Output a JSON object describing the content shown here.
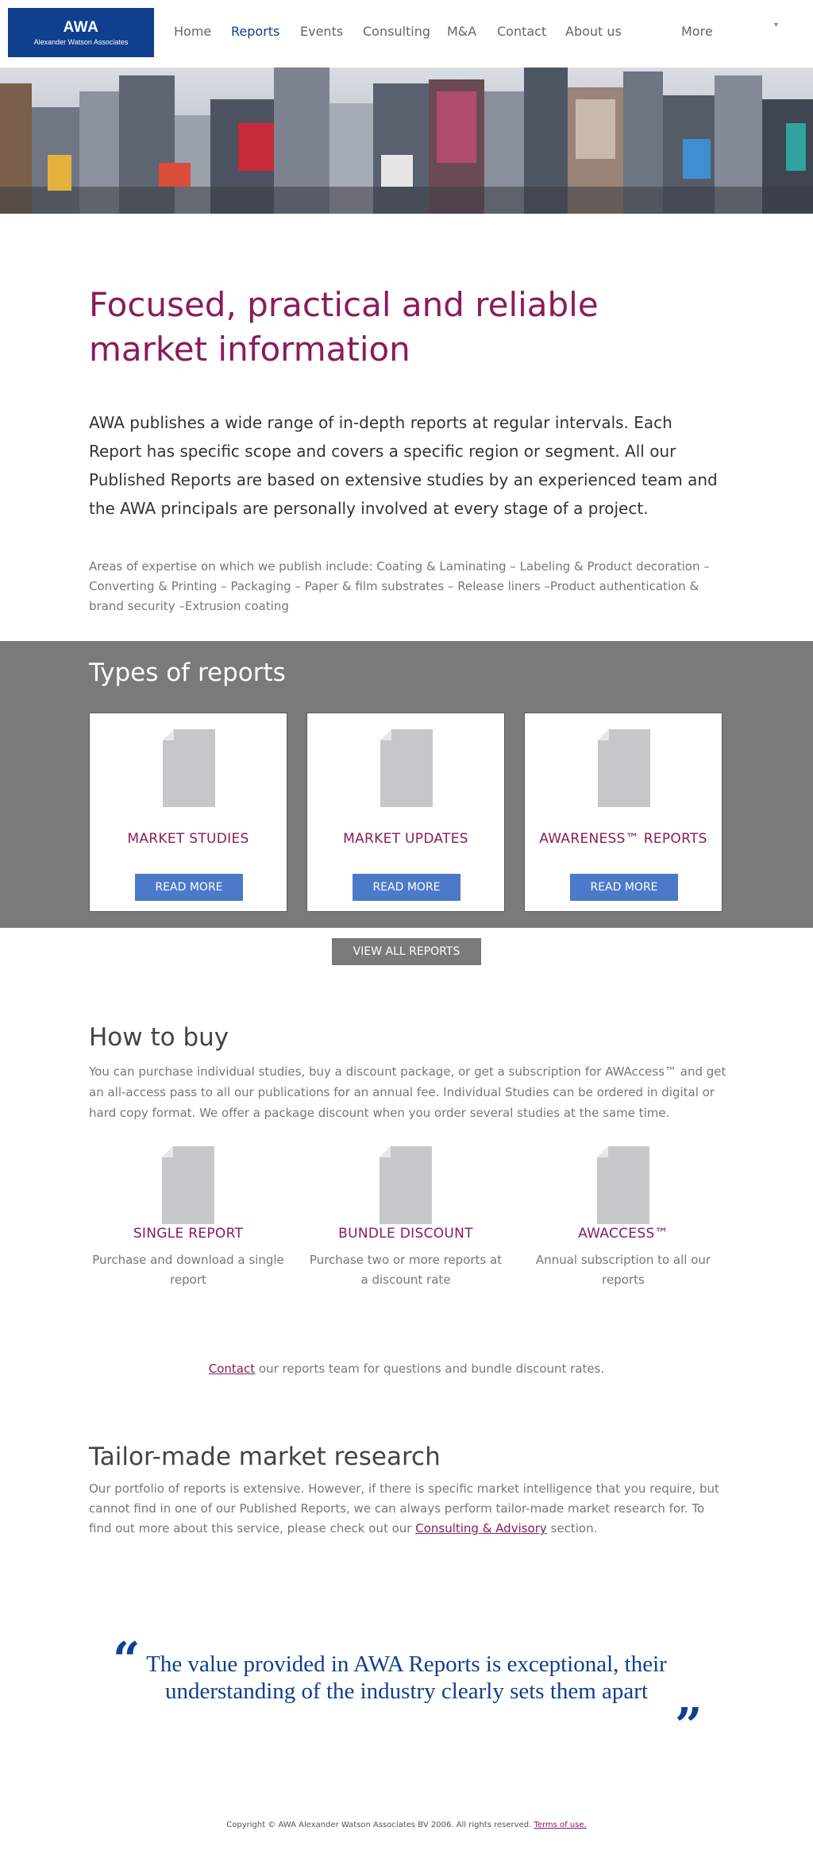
{
  "brand": {
    "logo_title": "AWA",
    "logo_subtitle": "Alexander Watson Associates",
    "accent_color": "#8b1a5d",
    "primary_color": "#0f3f8f",
    "button_color": "#4c79c8"
  },
  "nav": {
    "items": [
      {
        "label": "Home",
        "active": false
      },
      {
        "label": "Reports",
        "active": true
      },
      {
        "label": "Events",
        "active": false
      },
      {
        "label": "Consulting",
        "active": false
      },
      {
        "label": "M&A",
        "active": false
      },
      {
        "label": "Contact",
        "active": false
      },
      {
        "label": "About us",
        "active": false
      }
    ],
    "more_label": "More",
    "more_icon": "dropdown-caret-icon"
  },
  "intro": {
    "title": "Focused, practical and reliable market information",
    "lead": "AWA publishes a wide range of in-depth reports at regular intervals. Each Report has specific scope and covers a specific region or segment. All our Published Reports are based on extensive studies by an experienced team and the AWA principals are personally involved at every stage of a project.",
    "expertise": "Areas of expertise on which we publish include: Coating & Laminating – Labeling & Product decoration – Converting & Printing – Packaging – Paper & film substrates – Release liners –Product authentication & brand security –Extrusion coating"
  },
  "types": {
    "title": "Types of reports",
    "cards": [
      {
        "name": "MARKET STUDIES",
        "button": "READ MORE",
        "icon": "document-icon"
      },
      {
        "name": "MARKET UPDATES",
        "button": "READ MORE",
        "icon": "document-icon"
      },
      {
        "name": "AWARENESS™ REPORTS",
        "button": "READ MORE",
        "icon": "document-icon"
      }
    ],
    "view_all": "VIEW ALL REPORTS"
  },
  "buy": {
    "title": "How to buy",
    "text": "You can purchase individual studies, buy a discount package, or get a subscription for AWAccess™ and get an all-access pass to all our publications for an annual fee. Individual Studies can be ordered in digital or hard copy format. We offer a package discount when you order several studies at the same time.",
    "options": [
      {
        "name": "SINGLE REPORT",
        "desc": "Purchase and download a single report",
        "icon": "document-icon"
      },
      {
        "name": "BUNDLE DISCOUNT",
        "desc": "Purchase two or more reports at a discount rate",
        "icon": "document-icon"
      },
      {
        "name": "AWACCESS™",
        "desc": "Annual subscription to all our reports",
        "icon": "document-icon"
      }
    ],
    "contact_link": "Contact",
    "contact_rest": " our reports team for questions and bundle discount rates."
  },
  "tailor": {
    "title": "Tailor-made market research",
    "text_before": "Our portfolio of reports is extensive. However, if there is specific market intelligence that you require, but cannot find in one of our Published Reports, we can always perform tailor-made market research for. To find out more about this service, please check out our ",
    "link": "Consulting & Advisory",
    "text_after": " section."
  },
  "quote": {
    "open_mark": "“",
    "close_mark": "”",
    "text": "The value provided in AWA Reports is exceptional, their understanding of the industry clearly sets them apart"
  },
  "footer": {
    "copyright": "Copyright © AWA Alexander Watson Associates BV 2006. All rights reserved. ",
    "terms_link": "Terms of use."
  }
}
